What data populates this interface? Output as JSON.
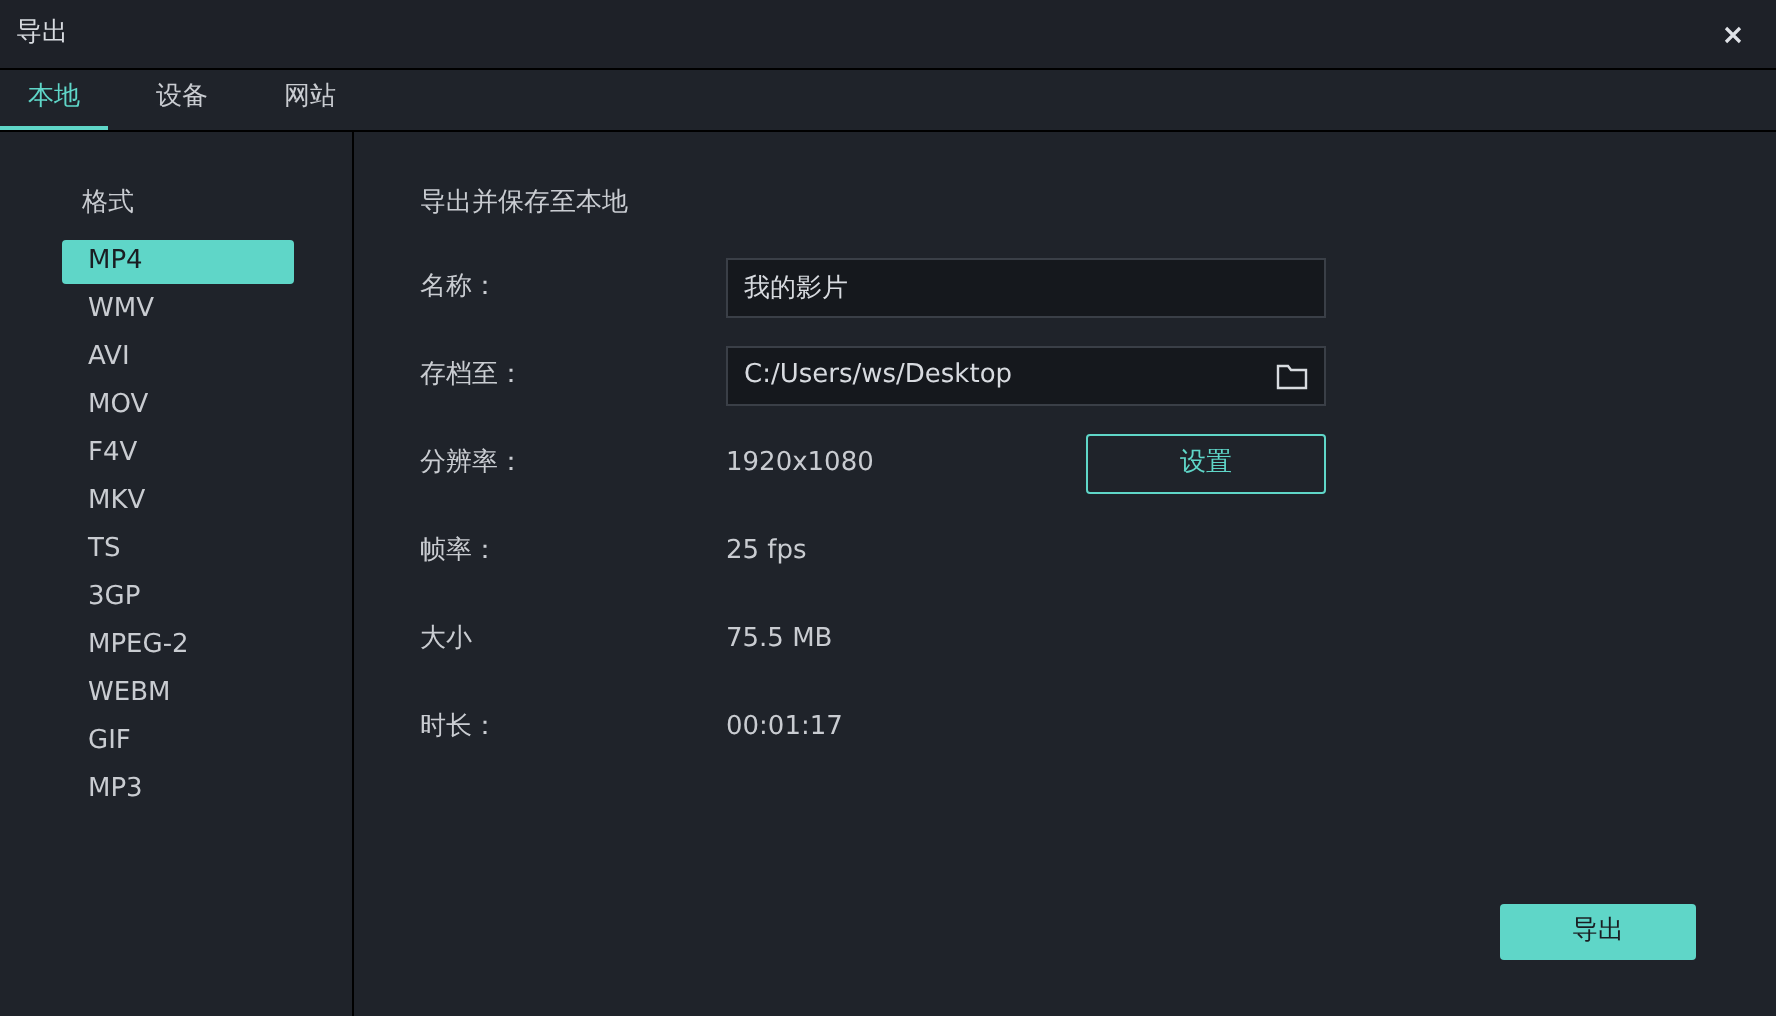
{
  "window": {
    "title": "导出"
  },
  "tabs": [
    {
      "label": "本地",
      "selected": true
    },
    {
      "label": "设备",
      "selected": false
    },
    {
      "label": "网站",
      "selected": false
    }
  ],
  "sidebar": {
    "heading": "格式",
    "items": [
      {
        "label": "MP4",
        "selected": true
      },
      {
        "label": "WMV",
        "selected": false
      },
      {
        "label": "AVI",
        "selected": false
      },
      {
        "label": "MOV",
        "selected": false
      },
      {
        "label": "F4V",
        "selected": false
      },
      {
        "label": "MKV",
        "selected": false
      },
      {
        "label": "TS",
        "selected": false
      },
      {
        "label": "3GP",
        "selected": false
      },
      {
        "label": "MPEG-2",
        "selected": false
      },
      {
        "label": "WEBM",
        "selected": false
      },
      {
        "label": "GIF",
        "selected": false
      },
      {
        "label": "MP3",
        "selected": false
      }
    ]
  },
  "panel": {
    "heading": "导出并保存至本地",
    "rows": [
      {
        "kind": "input",
        "label": "名称：",
        "value": "我的影片"
      },
      {
        "kind": "path",
        "label": "存档至：",
        "value": "C:/Users/ws/Desktop"
      },
      {
        "kind": "setting",
        "label": "分辨率：",
        "value": "1920x1080",
        "button": "设置"
      },
      {
        "kind": "text",
        "label": "帧率：",
        "value": "25 fps"
      },
      {
        "kind": "text",
        "label": "大小",
        "value": "75.5 MB"
      },
      {
        "kind": "text",
        "label": "时长：",
        "value": "00:01:17"
      }
    ]
  },
  "export_button": "导出"
}
